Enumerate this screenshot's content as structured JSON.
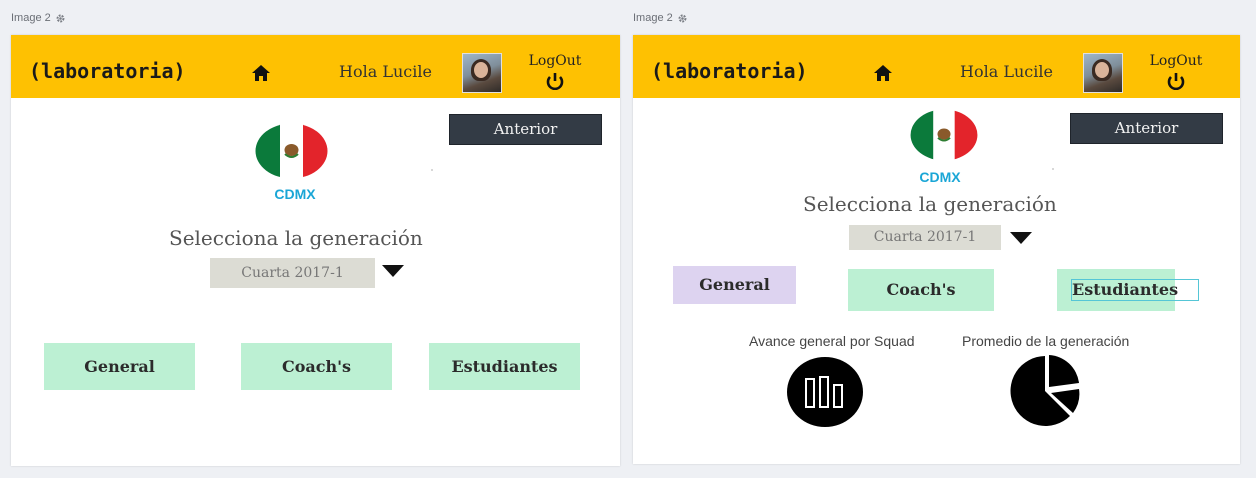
{
  "panels": [
    {
      "label": "Image 2",
      "header": {
        "logo": "(laboratoria)",
        "greeting": "Hola Lucile",
        "logout": "LogOut"
      },
      "anterior": "Anterior",
      "city": "CDMX",
      "generation_title": "Selecciona la generación",
      "generation_value": "Cuarta 2017-1",
      "buttons": {
        "general": "General",
        "coach": "Coach's",
        "students": "Estudiantes"
      }
    },
    {
      "label": "Image 2",
      "header": {
        "logo": "(laboratoria)",
        "greeting": "Hola Lucile",
        "logout": "LogOut"
      },
      "anterior": "Anterior",
      "city": "CDMX",
      "generation_title": "Selecciona la generación",
      "generation_value": "Cuarta 2017-1",
      "buttons": {
        "general": "General",
        "coach": "Coach's",
        "students": "Estudiantes"
      },
      "stats": {
        "squad_progress": "Avance general por Squad",
        "generation_average": "Promedio de la generación"
      }
    }
  ],
  "icons": [
    "gear-icon",
    "home-icon",
    "power-icon",
    "mexico-flag-icon",
    "caret-down-icon",
    "bar-chart-icon",
    "pie-chart-icon"
  ],
  "colors": {
    "topbar": "#fec102",
    "anterior_bg": "#333b45",
    "green_button": "#bcf0d3",
    "purple_button": "#ddd3f0",
    "city": "#1aa6d6"
  }
}
